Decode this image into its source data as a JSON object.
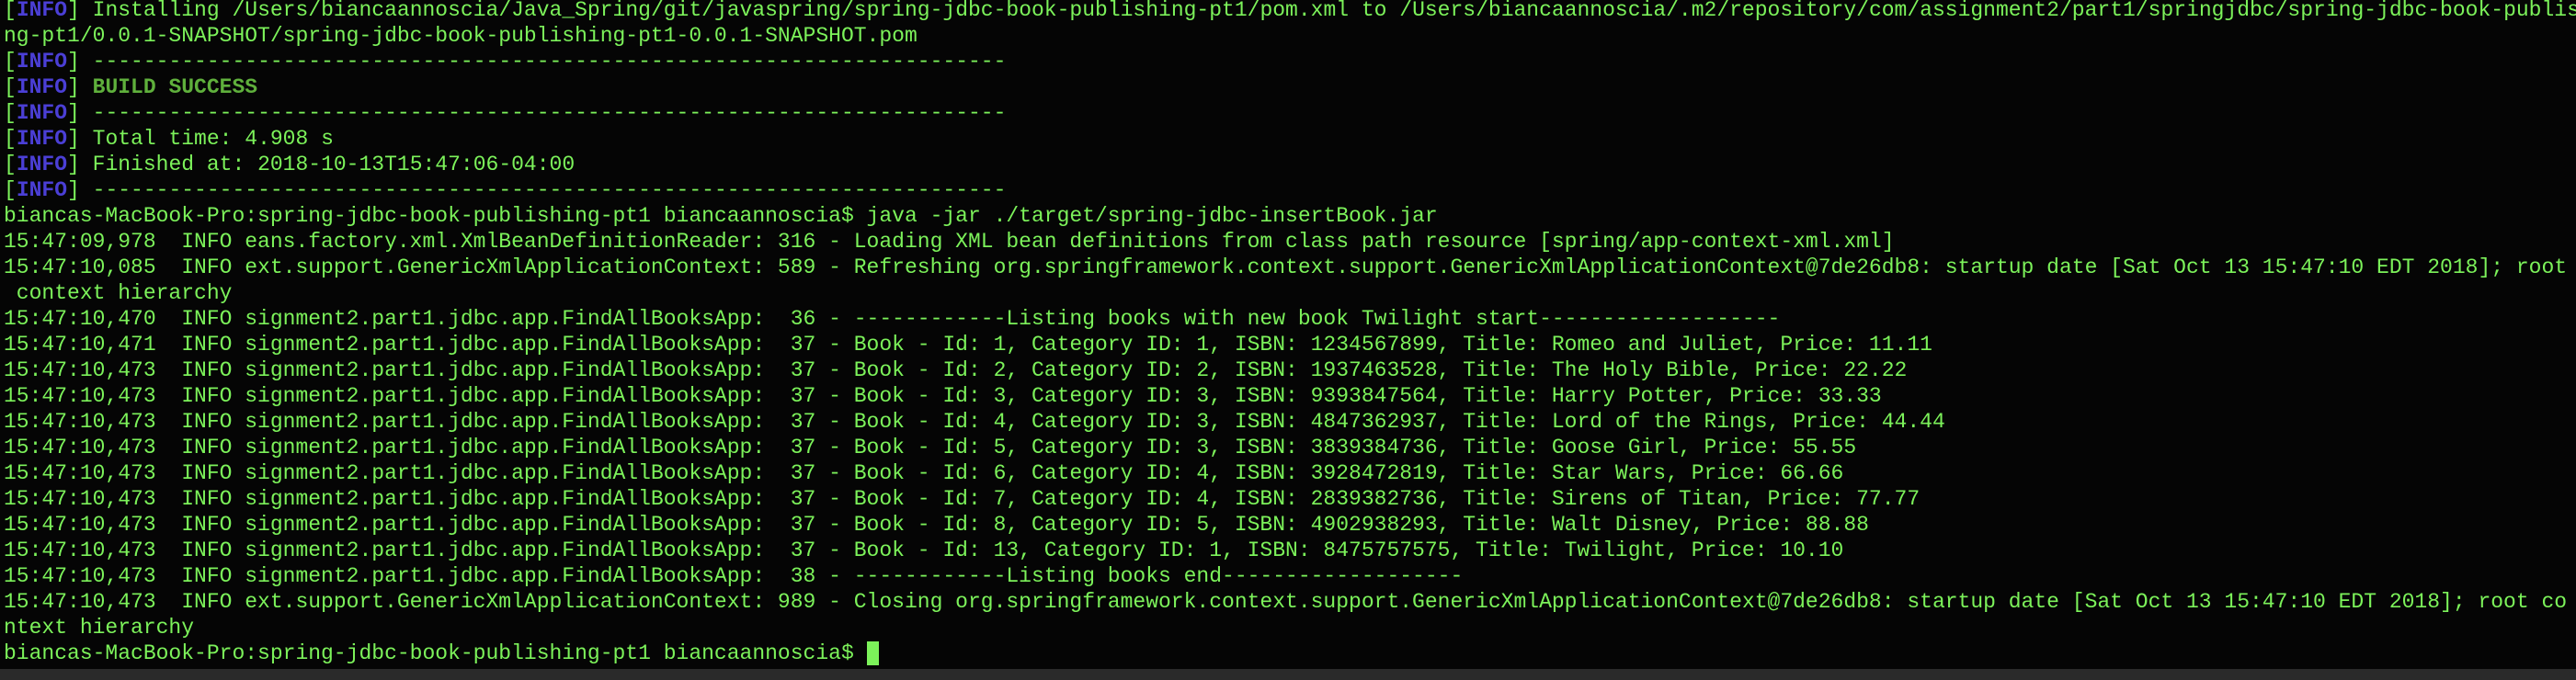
{
  "colors": {
    "background": "#050505",
    "text": "#7cf25a",
    "info_tag": "#4b3fd6",
    "success": "#5fb03c"
  },
  "terminal": {
    "info_tag": "INFO",
    "lines": [
      {
        "tag": true,
        "text": "Installing /Users/biancaannoscia/Java_Spring/git/javaspring/spring-jdbc-book-publishing-pt1/pom.xml to /Users/biancaannoscia/.m2/repository/com/assignment2/part1/springjdbc/spring-jdbc-book-publishi"
      },
      {
        "tag": false,
        "text": "ng-pt1/0.0.1-SNAPSHOT/spring-jdbc-book-publishing-pt1-0.0.1-SNAPSHOT.pom"
      },
      {
        "tag": true,
        "text": "------------------------------------------------------------------------"
      },
      {
        "tag": true,
        "text": "BUILD SUCCESS",
        "style": "success"
      },
      {
        "tag": true,
        "text": "------------------------------------------------------------------------"
      },
      {
        "tag": true,
        "text": "Total time: 4.908 s"
      },
      {
        "tag": true,
        "text": "Finished at: 2018-10-13T15:47:06-04:00"
      },
      {
        "tag": true,
        "text": "------------------------------------------------------------------------"
      },
      {
        "tag": false,
        "text": "biancas-MacBook-Pro:spring-jdbc-book-publishing-pt1 biancaannoscia$ java -jar ./target/spring-jdbc-insertBook.jar"
      },
      {
        "tag": false,
        "text": "15:47:09,978  INFO eans.factory.xml.XmlBeanDefinitionReader: 316 - Loading XML bean definitions from class path resource [spring/app-context-xml.xml]"
      },
      {
        "tag": false,
        "text": "15:47:10,085  INFO ext.support.GenericXmlApplicationContext: 589 - Refreshing org.springframework.context.support.GenericXmlApplicationContext@7de26db8: startup date [Sat Oct 13 15:47:10 EDT 2018]; root"
      },
      {
        "tag": false,
        "text": " context hierarchy"
      },
      {
        "tag": false,
        "text": "15:47:10,470  INFO signment2.part1.jdbc.app.FindAllBooksApp:  36 - ------------Listing books with new book Twilight start-------------------"
      },
      {
        "tag": false,
        "text": "15:47:10,471  INFO signment2.part1.jdbc.app.FindAllBooksApp:  37 - Book - Id: 1, Category ID: 1, ISBN: 1234567899, Title: Romeo and Juliet, Price: 11.11"
      },
      {
        "tag": false,
        "text": "15:47:10,473  INFO signment2.part1.jdbc.app.FindAllBooksApp:  37 - Book - Id: 2, Category ID: 2, ISBN: 1937463528, Title: The Holy Bible, Price: 22.22"
      },
      {
        "tag": false,
        "text": "15:47:10,473  INFO signment2.part1.jdbc.app.FindAllBooksApp:  37 - Book - Id: 3, Category ID: 3, ISBN: 9393847564, Title: Harry Potter, Price: 33.33"
      },
      {
        "tag": false,
        "text": "15:47:10,473  INFO signment2.part1.jdbc.app.FindAllBooksApp:  37 - Book - Id: 4, Category ID: 3, ISBN: 4847362937, Title: Lord of the Rings, Price: 44.44"
      },
      {
        "tag": false,
        "text": "15:47:10,473  INFO signment2.part1.jdbc.app.FindAllBooksApp:  37 - Book - Id: 5, Category ID: 3, ISBN: 3839384736, Title: Goose Girl, Price: 55.55"
      },
      {
        "tag": false,
        "text": "15:47:10,473  INFO signment2.part1.jdbc.app.FindAllBooksApp:  37 - Book - Id: 6, Category ID: 4, ISBN: 3928472819, Title: Star Wars, Price: 66.66"
      },
      {
        "tag": false,
        "text": "15:47:10,473  INFO signment2.part1.jdbc.app.FindAllBooksApp:  37 - Book - Id: 7, Category ID: 4, ISBN: 2839382736, Title: Sirens of Titan, Price: 77.77"
      },
      {
        "tag": false,
        "text": "15:47:10,473  INFO signment2.part1.jdbc.app.FindAllBooksApp:  37 - Book - Id: 8, Category ID: 5, ISBN: 4902938293, Title: Walt Disney, Price: 88.88"
      },
      {
        "tag": false,
        "text": "15:47:10,473  INFO signment2.part1.jdbc.app.FindAllBooksApp:  37 - Book - Id: 13, Category ID: 1, ISBN: 8475757575, Title: Twilight, Price: 10.10"
      },
      {
        "tag": false,
        "text": "15:47:10,473  INFO signment2.part1.jdbc.app.FindAllBooksApp:  38 - ------------Listing books end-------------------"
      },
      {
        "tag": false,
        "text": "15:47:10,473  INFO ext.support.GenericXmlApplicationContext: 989 - Closing org.springframework.context.support.GenericXmlApplicationContext@7de26db8: startup date [Sat Oct 13 15:47:10 EDT 2018]; root co"
      },
      {
        "tag": false,
        "text": "ntext hierarchy"
      }
    ],
    "prompt": "biancas-MacBook-Pro:spring-jdbc-book-publishing-pt1 biancaannoscia$ "
  }
}
